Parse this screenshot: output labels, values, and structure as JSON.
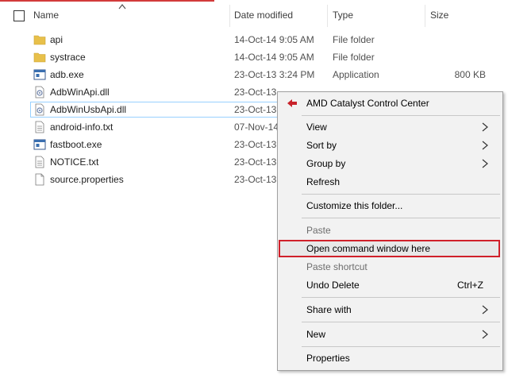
{
  "header": {
    "name": "Name",
    "date_modified": "Date modified",
    "type": "Type",
    "size": "Size"
  },
  "files": [
    {
      "name": "api",
      "date": "14-Oct-14 9:05 AM",
      "type": "File folder",
      "size": "",
      "icon": "folder-icon"
    },
    {
      "name": "systrace",
      "date": "14-Oct-14 9:05 AM",
      "type": "File folder",
      "size": "",
      "icon": "folder-icon"
    },
    {
      "name": "adb.exe",
      "date": "23-Oct-13 3:24 PM",
      "type": "Application",
      "size": "800 KB",
      "icon": "exe-icon"
    },
    {
      "name": "AdbWinApi.dll",
      "date": "23-Oct-13",
      "type": "",
      "size": "",
      "icon": "dll-icon"
    },
    {
      "name": "AdbWinUsbApi.dll",
      "date": "23-Oct-13",
      "type": "",
      "size": "",
      "icon": "dll-icon"
    },
    {
      "name": "android-info.txt",
      "date": "07-Nov-14",
      "type": "",
      "size": "",
      "icon": "text-file-icon"
    },
    {
      "name": "fastboot.exe",
      "date": "23-Oct-13",
      "type": "",
      "size": "",
      "icon": "exe-icon"
    },
    {
      "name": "NOTICE.txt",
      "date": "23-Oct-13",
      "type": "",
      "size": "",
      "icon": "text-file-icon"
    },
    {
      "name": "source.properties",
      "date": "23-Oct-13",
      "type": "",
      "size": "",
      "icon": "file-icon"
    }
  ],
  "context_menu": {
    "amd": "AMD Catalyst Control Center",
    "view": "View",
    "sort_by": "Sort by",
    "group_by": "Group by",
    "refresh": "Refresh",
    "customize": "Customize this folder...",
    "paste": "Paste",
    "open_cmd": "Open command window here",
    "paste_shortcut": "Paste shortcut",
    "undo_delete": "Undo Delete",
    "undo_shortcut": "Ctrl+Z",
    "share_with": "Share with",
    "new": "New",
    "properties": "Properties"
  },
  "colors": {
    "folder": "#e8c04a",
    "highlight_border": "#d0202a",
    "selection_border": "#99d1ff"
  }
}
